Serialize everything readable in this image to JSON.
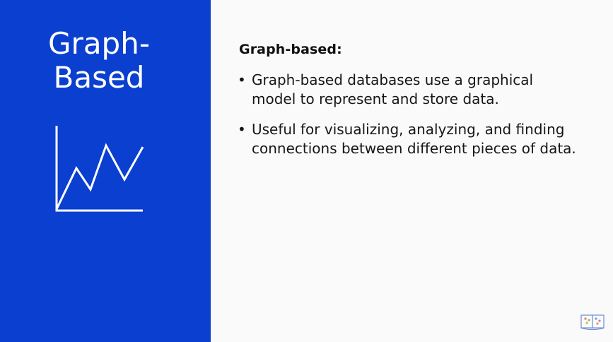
{
  "panel": {
    "title_line1": "Graph-",
    "title_line2": "Based",
    "icon": "line-graph-icon",
    "background_color": "#0b3fcf"
  },
  "content": {
    "heading": "Graph-based:",
    "bullets": [
      "Graph-based databases use a graphical model to represent and store data.",
      "Useful for visualizing, analyzing, and finding connections between different pieces of data."
    ]
  },
  "branding": {
    "logo_icon": "book-logo-icon"
  }
}
